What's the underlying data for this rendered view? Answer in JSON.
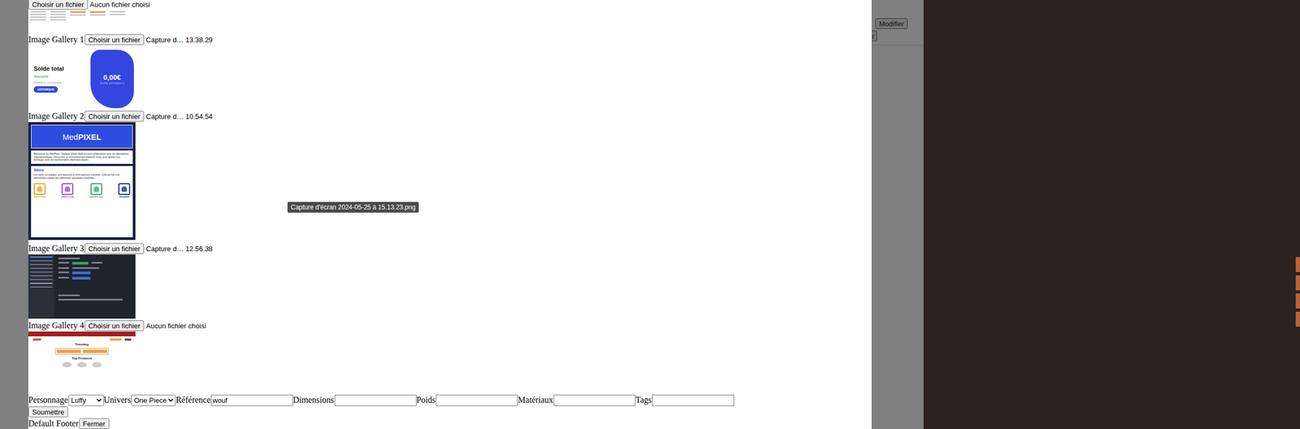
{
  "modal": {
    "uploads": [
      {
        "label": "",
        "button": "Choisir un fichier",
        "file": "Aucun fichier choisi",
        "preview": {
          "kind": "doc"
        }
      },
      {
        "label": "Image Gallery 1",
        "button": "Choisir un fichier",
        "file": "Capture d… 13.38.29",
        "preview": {
          "kind": "balance",
          "title": "Solde total",
          "status": "Aucune",
          "note": "Dernière connexion",
          "action": "HISTORIQUE",
          "amount": "0,00€",
          "amount_caption": "Solde permanent"
        }
      },
      {
        "label": "Image Gallery 2",
        "button": "Choisir un fichier",
        "file": "Capture d… 10.54.54",
        "preview": {
          "kind": "medpixel",
          "brand_light": "Med",
          "brand_bold": "PIXEL",
          "intro": "Bienvenue sur MedPixel, l'espace virtuel dédié à votre collaboration avec les laboratoires pharmaceutiques. Découvrez un environnement interactif conçu pour faciliter vos échanges avec les représentants pharmaceutiques.",
          "section": "Skins",
          "section_text": "Les skins, ou avatars, sont associés à votre parcours d'activité. Cela permet une identification rapide des différentes spécialités médicales.",
          "skins": [
            {
              "label": "ANESTHÉSIE",
              "color": "#f0a020"
            },
            {
              "label": "CARDIOLOGIE",
              "color": "#8a4fd8"
            },
            {
              "label": "GASTROLOGIE",
              "color": "#2faa6a"
            },
            {
              "label": "PEDIATRIE",
              "color": "#1e2f8a"
            }
          ]
        }
      },
      {
        "label": "Image Gallery 3",
        "button": "Choisir un fichier",
        "file": "Capture d… 12.56.38",
        "preview": {
          "kind": "admin"
        }
      },
      {
        "label": "Image Gallery 4",
        "button": "Choisir un fichier",
        "file": "Aucun fichier choisi",
        "preview": {
          "kind": "shop",
          "heading": "Trending",
          "section": "Top Products"
        }
      }
    ],
    "fields": [
      {
        "label": "Personnage",
        "kind": "select",
        "value": "Luffy"
      },
      {
        "label": "Univers",
        "kind": "select",
        "value": "One Piece"
      },
      {
        "label": "Référence",
        "kind": "input",
        "value": "wouf"
      },
      {
        "label": "Dimensions",
        "kind": "input",
        "value": ""
      },
      {
        "label": "Poids",
        "kind": "input",
        "value": ""
      },
      {
        "label": "Matériaux",
        "kind": "input",
        "value": ""
      },
      {
        "label": "Tags",
        "kind": "input",
        "value": ""
      }
    ],
    "submit": "Soumettre",
    "footer": {
      "text": "Default Footer",
      "close": "Fermer"
    },
    "tooltip": "Capture d'écran 2024-05-25 à 15.13.23.png"
  },
  "background": {
    "buttons": [
      "Modifier",
      "r"
    ]
  }
}
